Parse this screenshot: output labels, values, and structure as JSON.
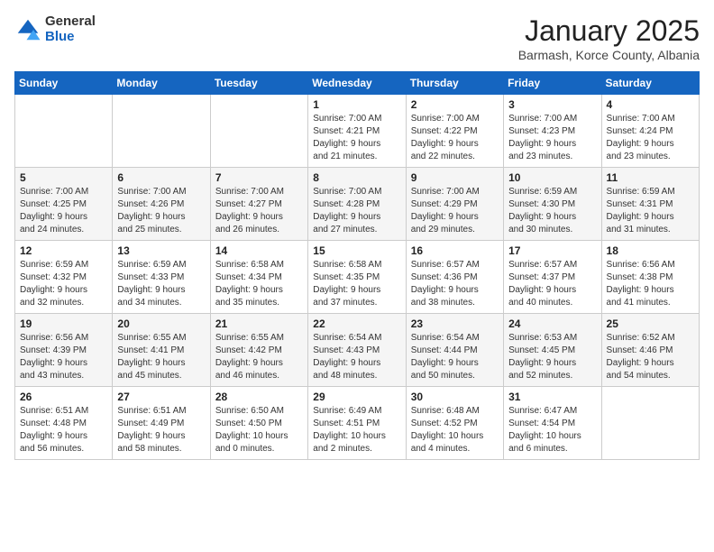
{
  "header": {
    "logo": {
      "general": "General",
      "blue": "Blue"
    },
    "title": "January 2025",
    "location": "Barmash, Korce County, Albania"
  },
  "days_of_week": [
    "Sunday",
    "Monday",
    "Tuesday",
    "Wednesday",
    "Thursday",
    "Friday",
    "Saturday"
  ],
  "weeks": [
    [
      {
        "day": "",
        "info": ""
      },
      {
        "day": "",
        "info": ""
      },
      {
        "day": "",
        "info": ""
      },
      {
        "day": "1",
        "info": "Sunrise: 7:00 AM\nSunset: 4:21 PM\nDaylight: 9 hours\nand 21 minutes."
      },
      {
        "day": "2",
        "info": "Sunrise: 7:00 AM\nSunset: 4:22 PM\nDaylight: 9 hours\nand 22 minutes."
      },
      {
        "day": "3",
        "info": "Sunrise: 7:00 AM\nSunset: 4:23 PM\nDaylight: 9 hours\nand 23 minutes."
      },
      {
        "day": "4",
        "info": "Sunrise: 7:00 AM\nSunset: 4:24 PM\nDaylight: 9 hours\nand 23 minutes."
      }
    ],
    [
      {
        "day": "5",
        "info": "Sunrise: 7:00 AM\nSunset: 4:25 PM\nDaylight: 9 hours\nand 24 minutes."
      },
      {
        "day": "6",
        "info": "Sunrise: 7:00 AM\nSunset: 4:26 PM\nDaylight: 9 hours\nand 25 minutes."
      },
      {
        "day": "7",
        "info": "Sunrise: 7:00 AM\nSunset: 4:27 PM\nDaylight: 9 hours\nand 26 minutes."
      },
      {
        "day": "8",
        "info": "Sunrise: 7:00 AM\nSunset: 4:28 PM\nDaylight: 9 hours\nand 27 minutes."
      },
      {
        "day": "9",
        "info": "Sunrise: 7:00 AM\nSunset: 4:29 PM\nDaylight: 9 hours\nand 29 minutes."
      },
      {
        "day": "10",
        "info": "Sunrise: 6:59 AM\nSunset: 4:30 PM\nDaylight: 9 hours\nand 30 minutes."
      },
      {
        "day": "11",
        "info": "Sunrise: 6:59 AM\nSunset: 4:31 PM\nDaylight: 9 hours\nand 31 minutes."
      }
    ],
    [
      {
        "day": "12",
        "info": "Sunrise: 6:59 AM\nSunset: 4:32 PM\nDaylight: 9 hours\nand 32 minutes."
      },
      {
        "day": "13",
        "info": "Sunrise: 6:59 AM\nSunset: 4:33 PM\nDaylight: 9 hours\nand 34 minutes."
      },
      {
        "day": "14",
        "info": "Sunrise: 6:58 AM\nSunset: 4:34 PM\nDaylight: 9 hours\nand 35 minutes."
      },
      {
        "day": "15",
        "info": "Sunrise: 6:58 AM\nSunset: 4:35 PM\nDaylight: 9 hours\nand 37 minutes."
      },
      {
        "day": "16",
        "info": "Sunrise: 6:57 AM\nSunset: 4:36 PM\nDaylight: 9 hours\nand 38 minutes."
      },
      {
        "day": "17",
        "info": "Sunrise: 6:57 AM\nSunset: 4:37 PM\nDaylight: 9 hours\nand 40 minutes."
      },
      {
        "day": "18",
        "info": "Sunrise: 6:56 AM\nSunset: 4:38 PM\nDaylight: 9 hours\nand 41 minutes."
      }
    ],
    [
      {
        "day": "19",
        "info": "Sunrise: 6:56 AM\nSunset: 4:39 PM\nDaylight: 9 hours\nand 43 minutes."
      },
      {
        "day": "20",
        "info": "Sunrise: 6:55 AM\nSunset: 4:41 PM\nDaylight: 9 hours\nand 45 minutes."
      },
      {
        "day": "21",
        "info": "Sunrise: 6:55 AM\nSunset: 4:42 PM\nDaylight: 9 hours\nand 46 minutes."
      },
      {
        "day": "22",
        "info": "Sunrise: 6:54 AM\nSunset: 4:43 PM\nDaylight: 9 hours\nand 48 minutes."
      },
      {
        "day": "23",
        "info": "Sunrise: 6:54 AM\nSunset: 4:44 PM\nDaylight: 9 hours\nand 50 minutes."
      },
      {
        "day": "24",
        "info": "Sunrise: 6:53 AM\nSunset: 4:45 PM\nDaylight: 9 hours\nand 52 minutes."
      },
      {
        "day": "25",
        "info": "Sunrise: 6:52 AM\nSunset: 4:46 PM\nDaylight: 9 hours\nand 54 minutes."
      }
    ],
    [
      {
        "day": "26",
        "info": "Sunrise: 6:51 AM\nSunset: 4:48 PM\nDaylight: 9 hours\nand 56 minutes."
      },
      {
        "day": "27",
        "info": "Sunrise: 6:51 AM\nSunset: 4:49 PM\nDaylight: 9 hours\nand 58 minutes."
      },
      {
        "day": "28",
        "info": "Sunrise: 6:50 AM\nSunset: 4:50 PM\nDaylight: 10 hours\nand 0 minutes."
      },
      {
        "day": "29",
        "info": "Sunrise: 6:49 AM\nSunset: 4:51 PM\nDaylight: 10 hours\nand 2 minutes."
      },
      {
        "day": "30",
        "info": "Sunrise: 6:48 AM\nSunset: 4:52 PM\nDaylight: 10 hours\nand 4 minutes."
      },
      {
        "day": "31",
        "info": "Sunrise: 6:47 AM\nSunset: 4:54 PM\nDaylight: 10 hours\nand 6 minutes."
      },
      {
        "day": "",
        "info": ""
      }
    ]
  ]
}
